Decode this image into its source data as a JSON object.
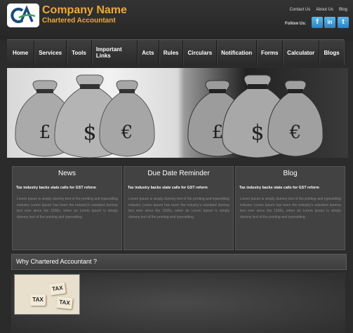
{
  "brand": {
    "logo_text": "CA",
    "name": "Company Name",
    "subtitle": "Chartered Accountant",
    "accent_color": "#f0a838"
  },
  "top_links": [
    "Contact Us",
    "About Us",
    "Blog"
  ],
  "follow": {
    "label": "Follow Us:",
    "icons": [
      {
        "name": "facebook-icon",
        "glyph": "f"
      },
      {
        "name": "linkedin-icon",
        "glyph": "in"
      },
      {
        "name": "twitter-icon",
        "glyph": "t"
      }
    ]
  },
  "nav": [
    "Home",
    "Services",
    "Tools",
    "Important Links",
    "Acts",
    "Rules",
    "Circulars",
    "Notification",
    "Forms",
    "Calculator",
    "Blogs"
  ],
  "banner": {
    "symbols": [
      "£",
      "$",
      "€",
      "£",
      "$",
      "€"
    ]
  },
  "panels": [
    {
      "title": "News",
      "headline": "Tax industry backs state calls for GST reform",
      "text": "Lorem Ipsum is simply dummy text of the printing and typesetting industry Lorem Ipsum has been the industry's standard dummy text ever since the 1500s, when an Lorem Ipsum is simply dummy text of the printing and typesetting"
    },
    {
      "title": "Due Date Reminder",
      "headline": "Tax industry backs state calls for GST reform",
      "text": "Lorem Ipsum is simply dummy text of the printing and typesetting industry Lorem Ipsum has been the industry's standard dummy text ever since the 1500s, when an Lorem Ipsum is simply dummy text of the printing and typesetting"
    },
    {
      "title": "Blog",
      "headline": "Tax industry backs state calls for GST reform",
      "text": "Lorem Ipsum is simply dummy text of the printing and typesetting industry Lorem Ipsum has been the industry's standard dummy text ever since the 1500s, when an Lorem Ipsum is simply dummy text of the printing and typesetting"
    }
  ],
  "why": {
    "title": "Why Chartered Accountant ?",
    "tiles": [
      "TAX",
      "TAX",
      "TAX"
    ]
  }
}
